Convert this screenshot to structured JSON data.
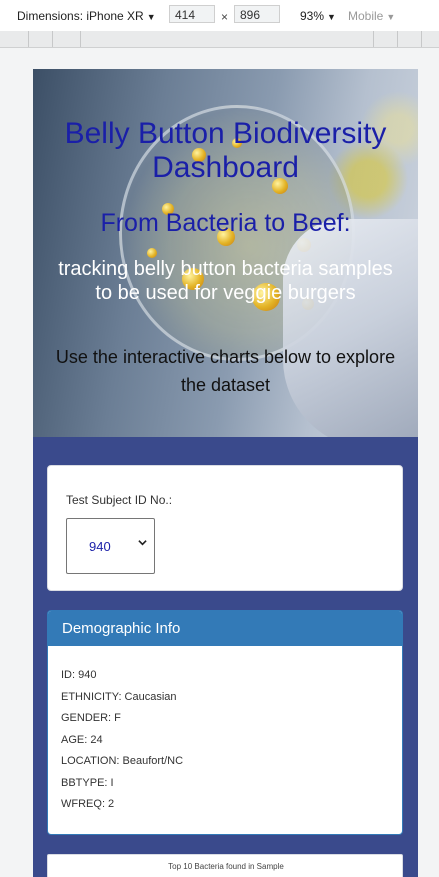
{
  "devtools": {
    "dimensions_label": "Dimensions: iPhone XR",
    "width": "414",
    "height": "896",
    "times": "×",
    "zoom": "93%",
    "mode": "Mobile"
  },
  "hero": {
    "title": "Belly Button Biodiversity Dashboard",
    "subtitle": "From Bacteria to Beef:",
    "tagline": "tracking belly button bacteria samples to be used for veggie burgers",
    "help": "Use the interactive charts below to explore the dataset"
  },
  "selector": {
    "label": "Test Subject ID No.:",
    "selected": "940"
  },
  "demographics": {
    "heading": "Demographic Info",
    "lines": [
      "ID: 940",
      "ETHNICITY: Caucasian",
      "GENDER: F",
      "AGE: 24",
      "LOCATION: Beaufort/NC",
      "BBTYPE: I",
      "WFREQ: 2"
    ]
  },
  "bar_chart": {
    "title": "Top 10 Bacteria found in Sample"
  }
}
